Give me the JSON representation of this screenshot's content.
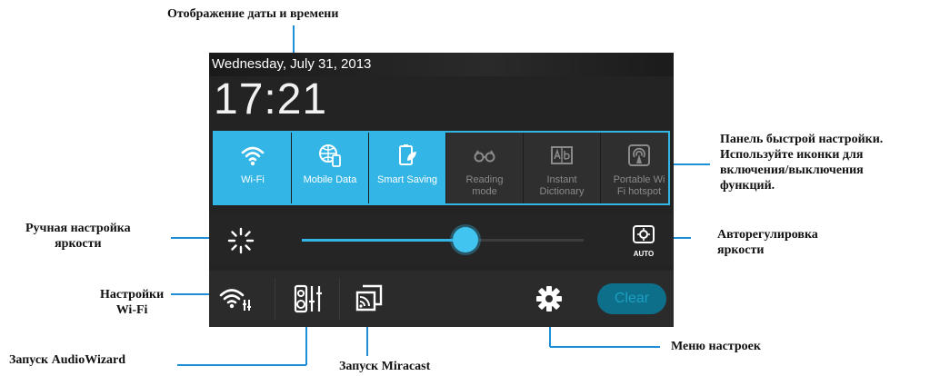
{
  "callouts": {
    "date_time": "Отображение даты и времени",
    "quick_settings": "Панель быстрой настройки.\nИспользуйте иконки для\nвключения/выключения\nфункций.",
    "manual_brightness": "Ручная настройка\nяркости",
    "auto_brightness": "Авторегулировка\nяркости",
    "wifi_settings": "Настройки\nWi-Fi",
    "audiowizard": "Запуск AudioWizard",
    "miracast": "Запуск Miracast",
    "settings_menu": "Меню настроек"
  },
  "status": {
    "date": "Wednesday, July 31, 2013",
    "time": "17:21"
  },
  "quick_settings": {
    "tiles": [
      {
        "label": "Wi-Fi",
        "state": "on",
        "icon": "wifi-icon"
      },
      {
        "label": "Mobile Data",
        "state": "on",
        "icon": "mobile-data-icon"
      },
      {
        "label": "Smart Saving",
        "state": "on",
        "icon": "smart-saving-icon"
      },
      {
        "label": "Reading\nmode",
        "state": "off",
        "icon": "reading-mode-icon"
      },
      {
        "label": "Instant\nDictionary",
        "state": "off",
        "icon": "instant-dictionary-icon"
      },
      {
        "label": "Portable Wi\nFi hotspot",
        "state": "off",
        "icon": "hotspot-icon"
      }
    ]
  },
  "brightness": {
    "level": 0.58,
    "auto_label": "AUTO"
  },
  "actions": {
    "clear_label": "Clear"
  },
  "colors": {
    "accent": "#33b5e5",
    "panel": "#232323"
  }
}
